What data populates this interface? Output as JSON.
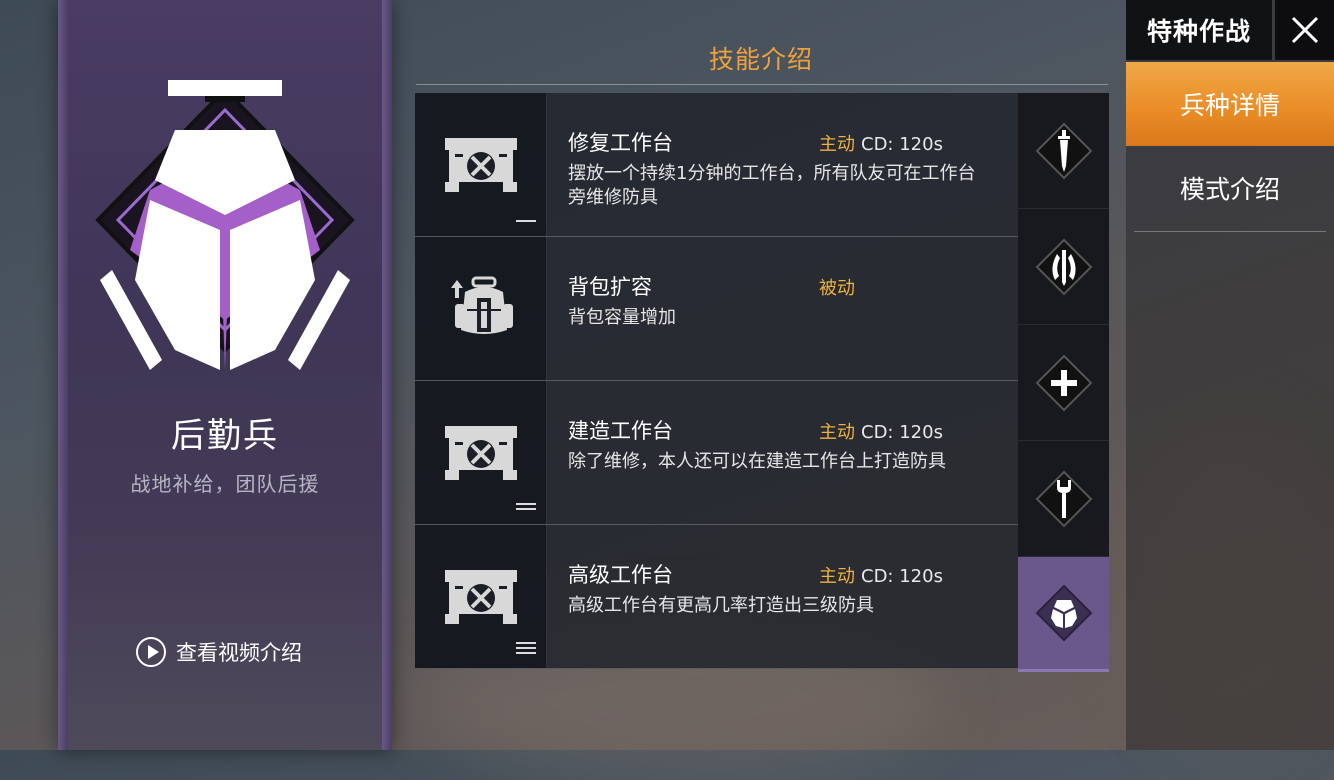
{
  "class_info": {
    "name": "后勤兵",
    "description": "战地补给，团队后援",
    "video_label": "查看视频介绍",
    "emblem_icon": "logistics-emblem-icon"
  },
  "skills_section": {
    "title": "技能介绍",
    "skills": [
      {
        "name": "修复工作台",
        "type": "主动",
        "cd": "CD: 120s",
        "description": "摆放一个持续1分钟的工作台，所有队友可在工作台旁维修防具",
        "icon": "workbench-icon",
        "level": 1
      },
      {
        "name": "背包扩容",
        "type": "被动",
        "cd": "",
        "description": "背包容量增加",
        "icon": "backpack-upgrade-icon",
        "level": 0
      },
      {
        "name": "建造工作台",
        "type": "主动",
        "cd": "CD: 120s",
        "description": "除了维修，本人还可以在建造工作台上打造防具",
        "icon": "workbench-icon",
        "level": 2
      },
      {
        "name": "高级工作台",
        "type": "主动",
        "cd": "CD: 120s",
        "description": "高级工作台有更高几率打造出三级防具",
        "icon": "workbench-icon",
        "level": 3
      }
    ]
  },
  "class_selector": [
    {
      "icon": "dagger-class-icon",
      "active": false
    },
    {
      "icon": "claw-class-icon",
      "active": false
    },
    {
      "icon": "medic-plus-class-icon",
      "active": false
    },
    {
      "icon": "wrench-class-icon",
      "active": false
    },
    {
      "icon": "logistics-class-icon",
      "active": true
    }
  ],
  "mode": {
    "title": "特种作战",
    "close_icon": "close-icon"
  },
  "menu": {
    "items": [
      {
        "label": "兵种详情",
        "active": true
      },
      {
        "label": "模式介绍",
        "active": false
      }
    ]
  },
  "colors": {
    "accent_orange": "#f0a23a",
    "active_menu": "#e98b25",
    "purple": "#6a588c",
    "skill_type": "#f0b23c"
  }
}
